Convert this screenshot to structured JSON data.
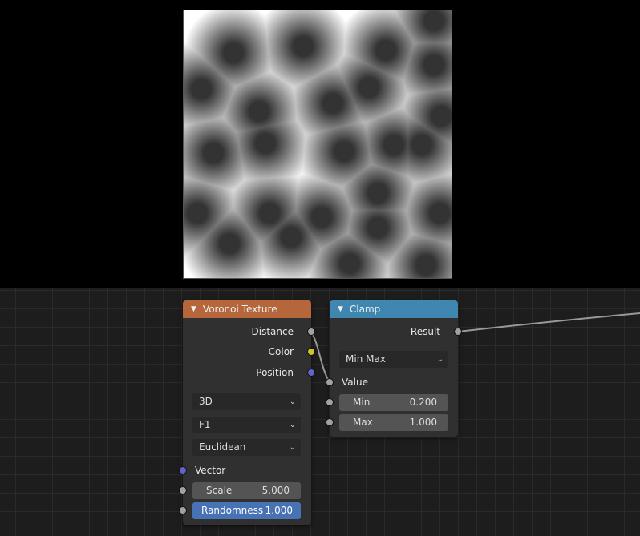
{
  "voronoi": {
    "title": "Voronoi Texture",
    "header_color": "#b5663b",
    "outputs": [
      "Distance",
      "Color",
      "Position"
    ],
    "dimensions": "3D",
    "feature": "F1",
    "metric": "Euclidean",
    "vector_label": "Vector",
    "scale": {
      "label": "Scale",
      "value": "5.000"
    },
    "randomness": {
      "label": "Randomness",
      "value": "1.000"
    }
  },
  "clamp": {
    "title": "Clamp",
    "header_color": "#3f86b0",
    "output": "Result",
    "clamp_type": "Min Max",
    "value_label": "Value",
    "min": {
      "label": "Min",
      "value": "0.200"
    },
    "max": {
      "label": "Max",
      "value": "1.000"
    }
  },
  "socket_colors": {
    "float": "#a1a1a1",
    "color": "#c7c729",
    "vector": "#6363c7"
  }
}
